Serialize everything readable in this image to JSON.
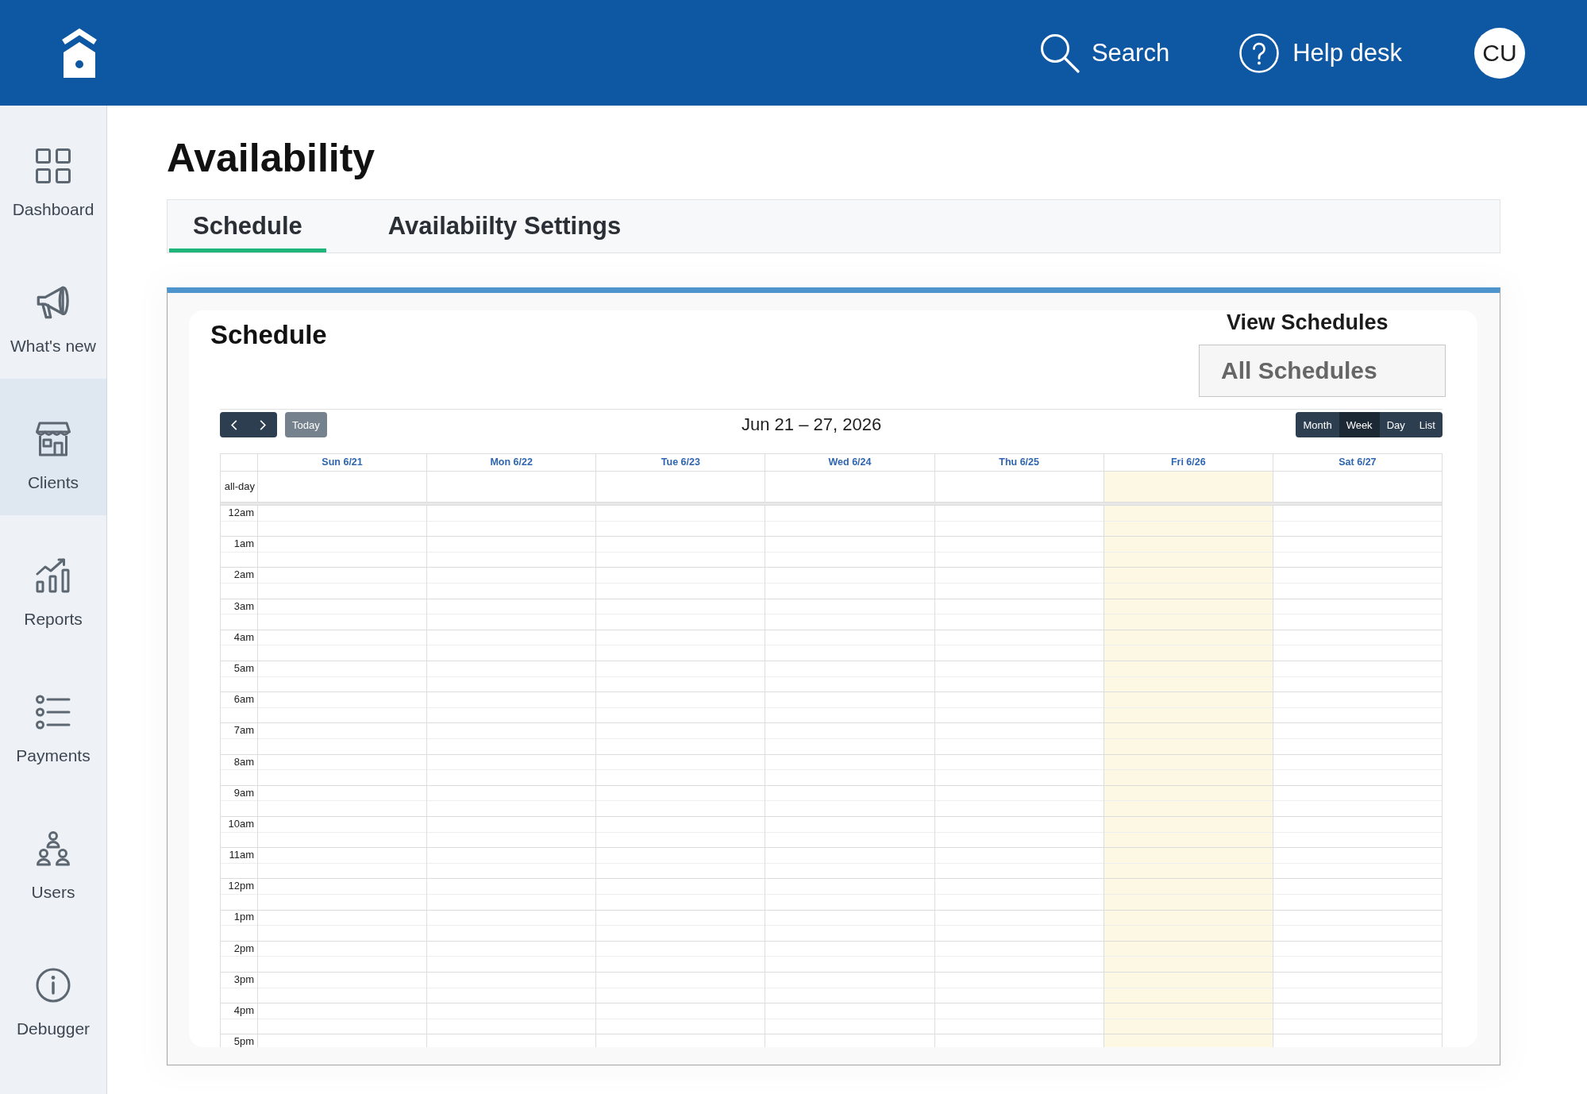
{
  "header": {
    "search": "Search",
    "help": "Help desk",
    "avatar": "CU"
  },
  "sidebar": {
    "items": [
      {
        "label": "Dashboard",
        "selected": false
      },
      {
        "label": "What's new",
        "selected": false
      },
      {
        "label": "Clients",
        "selected": true
      },
      {
        "label": "Reports",
        "selected": false
      },
      {
        "label": "Payments",
        "selected": false
      },
      {
        "label": "Users",
        "selected": false
      },
      {
        "label": "Debugger",
        "selected": false
      }
    ]
  },
  "page": {
    "title": "Availability"
  },
  "tabs": [
    {
      "label": "Schedule",
      "selected": true
    },
    {
      "label": "Availabiilty Settings",
      "selected": false
    }
  ],
  "schedule": {
    "title": "Schedule",
    "view_label": "View Schedules",
    "view_select": {
      "value": "All Schedules"
    },
    "calendar": {
      "today_button": {
        "label": "Today",
        "disabled": true
      },
      "title": "Jun 21 – 27, 2026",
      "views": [
        {
          "label": "Month",
          "selected": false
        },
        {
          "label": "Week",
          "selected": true
        },
        {
          "label": "Day",
          "selected": false
        },
        {
          "label": "List",
          "selected": false
        }
      ],
      "days": [
        {
          "label": "Sun 6/21",
          "today": false
        },
        {
          "label": "Mon 6/22",
          "today": false
        },
        {
          "label": "Tue 6/23",
          "today": false
        },
        {
          "label": "Wed 6/24",
          "today": false
        },
        {
          "label": "Thu 6/25",
          "today": false
        },
        {
          "label": "Fri 6/26",
          "today": true
        },
        {
          "label": "Sat 6/27",
          "today": false
        }
      ],
      "all_day_label": "all-day",
      "hours": [
        "12am",
        "1am",
        "2am",
        "3am",
        "4am",
        "5am",
        "6am",
        "7am",
        "8am",
        "9am",
        "10am",
        "11am",
        "12pm",
        "1pm",
        "2pm",
        "3pm",
        "4pm",
        "5pm"
      ]
    }
  }
}
